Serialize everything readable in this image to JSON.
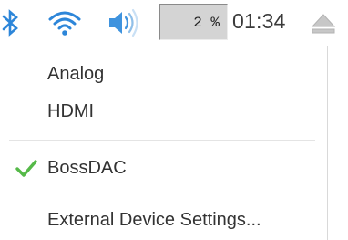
{
  "taskbar": {
    "icons": {
      "bluetooth": "bluetooth-icon",
      "wifi": "wifi-icon",
      "volume": "volume-icon",
      "eject": "eject-icon"
    },
    "cpu_usage": "2 %",
    "clock": "01:34"
  },
  "audio_menu": {
    "items": [
      {
        "label": "Analog",
        "selected": false
      },
      {
        "label": "HDMI",
        "selected": false
      },
      {
        "label": "BossDAC",
        "selected": true
      },
      {
        "label": "External Device Settings..."
      }
    ],
    "check_icon": "checkmark-icon"
  },
  "colors": {
    "accent_blue": "#2d86d9",
    "check_green": "#55b948",
    "cpu_bg": "#d4d4d4",
    "text": "#333333"
  }
}
